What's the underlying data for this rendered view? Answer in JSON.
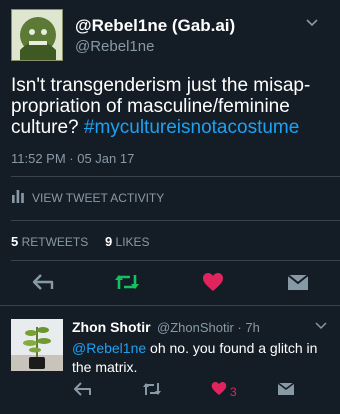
{
  "tweet": {
    "display_name": "@Rebel1ne (Gab.ai)",
    "handle": "@Rebel1ne",
    "text_main": "Isn't transgenderism just the misap-propriation of masculine/feminine culture? ",
    "hashtag": "#mycultureisnotacostume",
    "timestamp": "11:52 PM · 05 Jan 17",
    "activity_label": "VIEW TWEET ACTIVITY",
    "retweets_count": "5",
    "retweets_label": "RETWEETS",
    "likes_count": "9",
    "likes_label": "LIKES"
  },
  "reply": {
    "display_name": "Zhon Shotir",
    "meta": "@ZhonShotir · 7h",
    "mention": "@Rebel1ne",
    "text": " oh no. you found a glitch in the matrix.",
    "like_count": "3"
  },
  "colors": {
    "background": "#141d26",
    "accent": "#1da1f2",
    "retweet_green": "#17bf63",
    "like_red": "#e0245e",
    "muted": "#8899a6"
  },
  "icons": [
    "caret-down-icon",
    "reply-icon",
    "retweet-icon",
    "heart-icon",
    "message-icon",
    "bar-chart-icon"
  ]
}
